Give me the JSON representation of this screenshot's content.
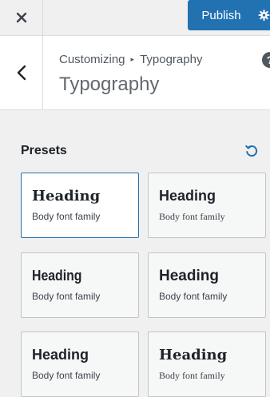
{
  "topbar": {
    "close_icon": "close-icon",
    "publish_label": "Publish",
    "gear_icon": "gear-icon"
  },
  "header": {
    "back_icon": "chevron-left-icon",
    "breadcrumb_root": "Customizing",
    "breadcrumb_separator": "▸",
    "breadcrumb_current": "Typography",
    "title": "Typography",
    "help_label": "?"
  },
  "presets": {
    "label": "Presets",
    "reset_icon": "reset-icon",
    "items": [
      {
        "heading": "Heading",
        "body": "Body font family",
        "selected": true
      },
      {
        "heading": "Heading",
        "body": "Body font family",
        "selected": false
      },
      {
        "heading": "Heading",
        "body": "Body font family",
        "selected": false
      },
      {
        "heading": "Heading",
        "body": "Body font family",
        "selected": false
      },
      {
        "heading": "Heading",
        "body": "Body font family",
        "selected": false
      },
      {
        "heading": "Heading",
        "body": "Body font family",
        "selected": false
      }
    ]
  },
  "colors": {
    "accent": "#2271b1",
    "background": "#f0f0f1"
  }
}
